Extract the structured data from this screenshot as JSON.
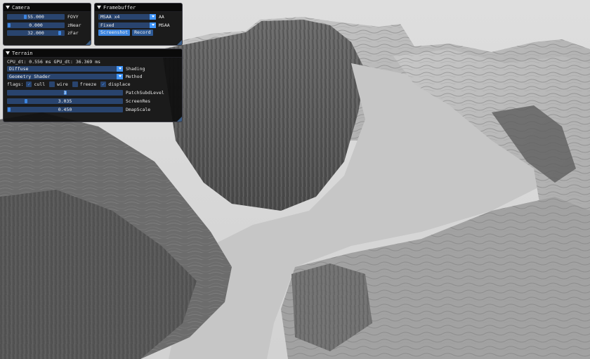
{
  "camera": {
    "title": "Camera",
    "fovy": {
      "value": "55.000",
      "label": "FOVY",
      "fraction": 0.3
    },
    "znear": {
      "value": "0.000",
      "label": "zNear",
      "fraction": 0.0
    },
    "zfar": {
      "value": "32.000",
      "label": "zFar",
      "fraction": 0.95
    }
  },
  "framebuffer": {
    "title": "Framebuffer",
    "aa": {
      "value": "MSAA x4",
      "label": "AA"
    },
    "msaa": {
      "value": "Fixed",
      "label": "MSAA"
    },
    "screenshot_label": "Screenshot",
    "record_label": "Record"
  },
  "terrain": {
    "title": "Terrain",
    "timing": "CPU_dt: 0.556 ms GPU_dt: 36.369 ms",
    "shading": {
      "value": "Diffuse",
      "label": "Shading"
    },
    "method": {
      "value": "Geometry Shader",
      "label": "Method"
    },
    "flags_label": "flags:",
    "cull_label": "cull",
    "wire_label": "wire",
    "freeze_label": "freeze",
    "displace_label": "displace",
    "cull_checked": true,
    "wire_checked": false,
    "freeze_checked": false,
    "displace_checked": true,
    "patch_subd": {
      "value": "3",
      "label": "PatchSubdLevel",
      "fraction": 0.5
    },
    "screen_res": {
      "value": "3.035",
      "label": "ScreenRes",
      "fraction": 0.15
    },
    "dmap_scale": {
      "value": "0.450",
      "label": "DmapScale",
      "fraction": 0.0
    }
  },
  "colors": {
    "accent": "#4296fa",
    "frame_bg": "#29446e",
    "window_bg": "#0f0f0f"
  }
}
